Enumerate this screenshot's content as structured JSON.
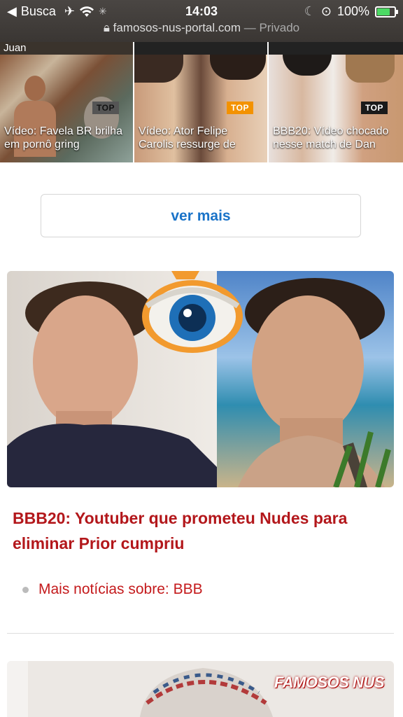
{
  "status_bar": {
    "back_app": "Busca",
    "time": "14:03",
    "battery": "100%"
  },
  "url_bar": {
    "domain": "famosos-nus-portal.com",
    "mode": "— Privado"
  },
  "thumbnails": [
    {
      "caption": "Vídeo: Favela BR brilha em pornô gring",
      "badge": "TOP",
      "top_text": "Juan"
    },
    {
      "caption": "Vídeo: Ator Felipe Carolis ressurge de",
      "badge": "TOP"
    },
    {
      "caption": "BBB20: Vídeo chocado nesse match de Dan",
      "badge": "TOP"
    }
  ],
  "ver_mais": "ver mais",
  "article": {
    "headline": "BBB20: Youtuber que prometeu Nudes para eliminar Prior cumpriu",
    "more_news": "Mais notícias sobre: BBB"
  },
  "next_article": {
    "watermark": "FAMOSOS NUS"
  },
  "colors": {
    "link_blue": "#1a73c8",
    "headline_red": "#b3171b",
    "badge_orange": "#f39200"
  }
}
